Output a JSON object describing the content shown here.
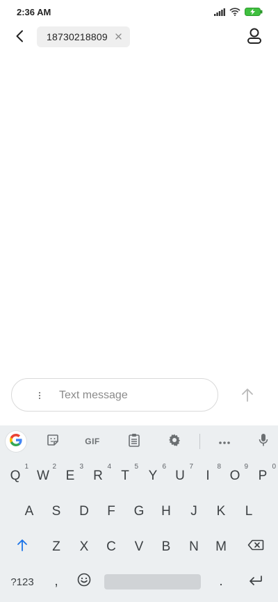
{
  "status_bar": {
    "time": "2:36 AM",
    "icons": [
      "signal-icon",
      "wifi-icon",
      "battery-charging-icon"
    ]
  },
  "header": {
    "back_icon": "back-arrow-icon",
    "recipient": "18730218809",
    "chip_close_icon": "close-icon",
    "contact_icon": "contact-icon"
  },
  "compose": {
    "placeholder": "Text message",
    "value": "",
    "more_icon": "more-vertical-icon",
    "send_icon": "send-arrow-icon"
  },
  "keyboard": {
    "toolbar": {
      "gif_label": "GIF",
      "items": [
        "google-icon",
        "sticker-icon",
        "gif-icon",
        "clipboard-icon",
        "settings-icon",
        "more-horizontal-icon",
        "mic-icon"
      ]
    },
    "row1": [
      {
        "label": "Q",
        "hint": "1"
      },
      {
        "label": "W",
        "hint": "2"
      },
      {
        "label": "E",
        "hint": "3"
      },
      {
        "label": "R",
        "hint": "4"
      },
      {
        "label": "T",
        "hint": "5"
      },
      {
        "label": "Y",
        "hint": "6"
      },
      {
        "label": "U",
        "hint": "7"
      },
      {
        "label": "I",
        "hint": "8"
      },
      {
        "label": "O",
        "hint": "9"
      },
      {
        "label": "P",
        "hint": "0"
      }
    ],
    "row2": [
      "A",
      "S",
      "D",
      "F",
      "G",
      "H",
      "J",
      "K",
      "L"
    ],
    "row3": [
      "Z",
      "X",
      "C",
      "V",
      "B",
      "N",
      "M"
    ],
    "row4": {
      "symbols_label": "?123",
      "comma_label": ",",
      "period_label": "."
    },
    "accent_color": "#1a73e8"
  }
}
